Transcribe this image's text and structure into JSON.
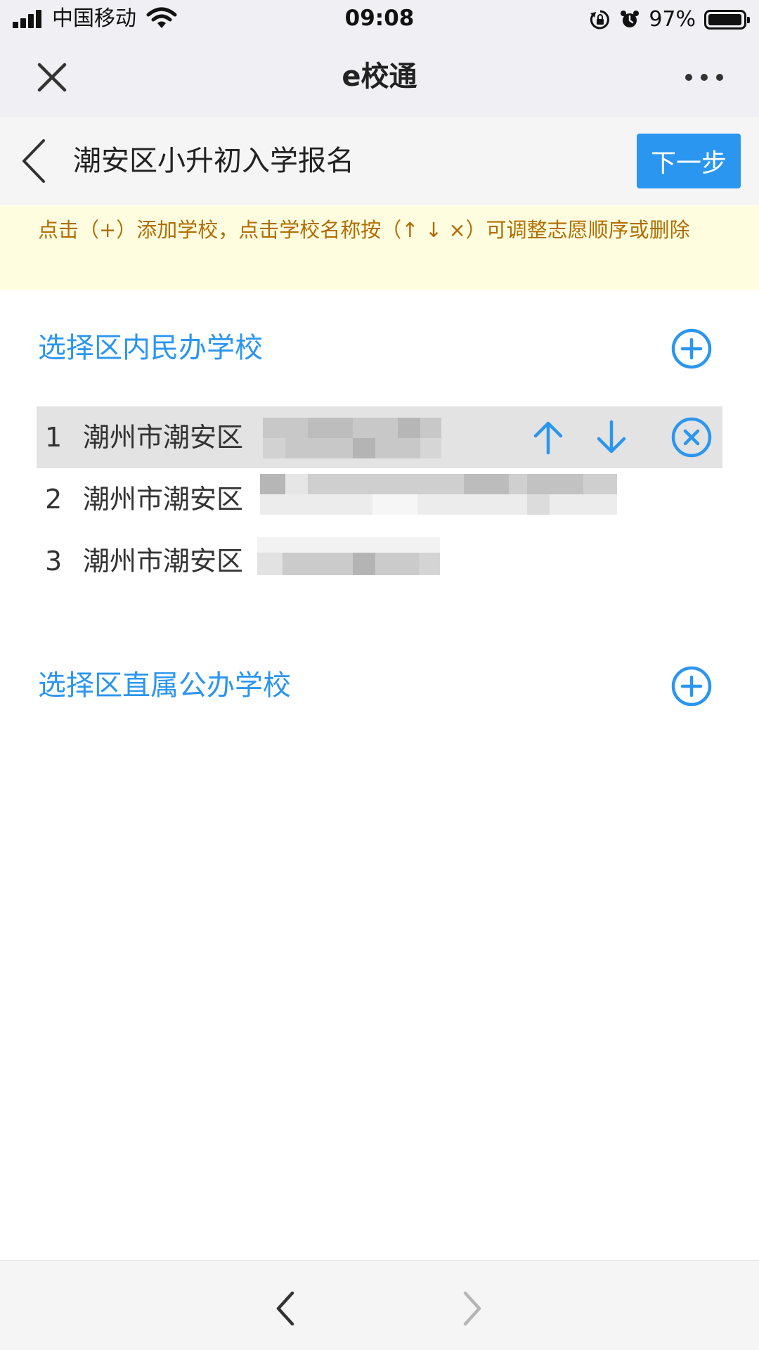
{
  "status_bar": {
    "carrier": "中国移动",
    "time": "09:08",
    "battery": "97%",
    "battery_level": 0.97
  },
  "app_bar": {
    "title": "e校通"
  },
  "page_header": {
    "title": "潮安区小升初入学报名",
    "next_label": "下一步"
  },
  "notice": {
    "text": "点击（+）添加学校，点击学校名称按（↑ ↓ ×）可调整志愿顺序或删除"
  },
  "sections": [
    {
      "title": "选择区内民办学校",
      "schools": [
        {
          "index": "1",
          "name": "潮州市潮安区"
        },
        {
          "index": "2",
          "name": "潮州市潮安区"
        },
        {
          "index": "3",
          "name": "潮州市潮安区"
        }
      ]
    },
    {
      "title": "选择区直属公办学校",
      "schools": []
    }
  ],
  "colors": {
    "accent": "#2b96f0",
    "notice_bg": "#fffde0",
    "notice_text": "#b06e00",
    "selected_row": "#e3e3e3"
  },
  "icons": {
    "close": "close-icon",
    "more": "more-icon",
    "back": "chevron-left-icon",
    "add": "plus-circle-icon",
    "move_up": "arrow-up-icon",
    "move_down": "arrow-down-icon",
    "delete": "close-circle-icon",
    "nav_back": "chevron-left-icon",
    "nav_forward": "chevron-right-icon"
  }
}
